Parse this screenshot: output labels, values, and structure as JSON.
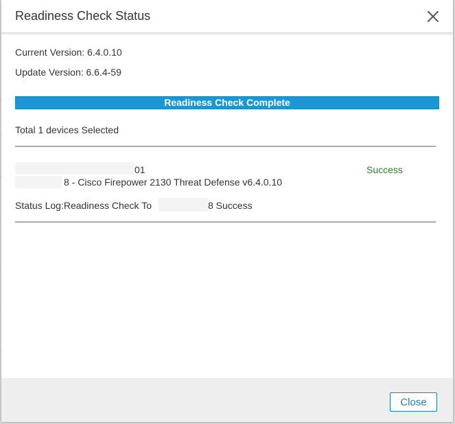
{
  "dialog": {
    "title": "Readiness Check Status",
    "close_icon": "close-icon"
  },
  "versions": {
    "current": "Current Version: 6.4.0.10",
    "update": "Update Version: 6.6.4-59"
  },
  "progress": {
    "label": "Readiness Check Complete",
    "value_percent": 100,
    "color": "#1b98d3"
  },
  "selection": {
    "summary": "Total 1 devices Selected"
  },
  "device": {
    "name_fragment": "01",
    "status": "Success",
    "description_fragment": "8 - Cisco Firepower 2130 Threat Defense v6.4.0.10",
    "status_color": "#1f8a1f"
  },
  "status_log": {
    "prefix": "Status Log:Readiness Check To",
    "suffix": "8 Success"
  },
  "footer": {
    "close_label": "Close",
    "accent": "#1b7fbf"
  }
}
